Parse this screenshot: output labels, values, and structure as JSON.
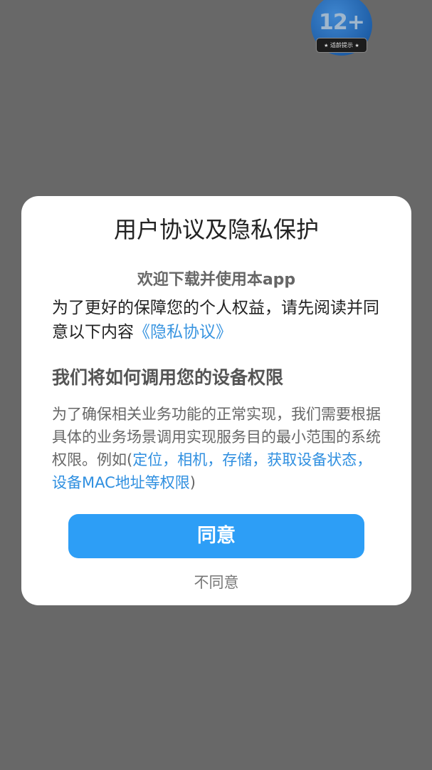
{
  "age_badge": {
    "rating": "12+",
    "label": "适龄提示"
  },
  "dialog": {
    "title": "用户协议及隐私保护",
    "welcome": "欢迎下载并使用本app",
    "intro_text": "为了更好的保障您的个人权益，请先阅读并同意以下内容",
    "privacy_link": "《隐私协议》",
    "section_title": "我们将如何调用您的设备权限",
    "section_body_prefix": "为了确保相关业务功能的正常实现，我们需要根据具体的业务场景调用实现服务目的最小范围的系统权限。例如(",
    "permissions_text": "定位，相机，存储，获取设备状态，设备MAC地址等权限",
    "section_body_suffix": ")",
    "agree_label": "同意",
    "disagree_label": "不同意"
  },
  "colors": {
    "overlay": "#686868",
    "accent": "#2d9ef6",
    "link": "#3a95e0"
  }
}
